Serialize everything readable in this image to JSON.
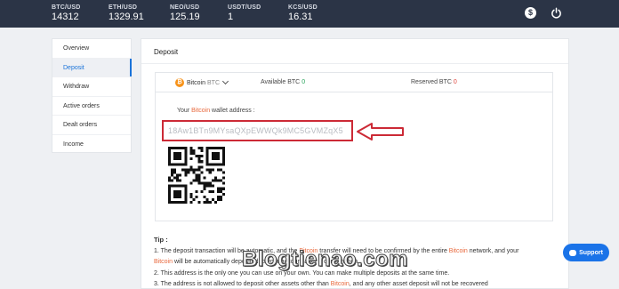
{
  "tickers": [
    {
      "pair": "BTC/USD",
      "price": "14312"
    },
    {
      "pair": "ETH/USD",
      "price": "1329.91"
    },
    {
      "pair": "NEO/USD",
      "price": "125.19"
    },
    {
      "pair": "USDT/USD",
      "price": "1"
    },
    {
      "pair": "KCS/USD",
      "price": "16.31"
    }
  ],
  "header": {
    "dollar_icon": "$",
    "power_icon": "power-icon"
  },
  "sidebar": {
    "items": [
      {
        "label": "Overview"
      },
      {
        "label": "Deposit"
      },
      {
        "label": "Withdraw"
      },
      {
        "label": "Active orders"
      },
      {
        "label": "Dealt orders"
      },
      {
        "label": "Income"
      }
    ],
    "active_index": 1
  },
  "main": {
    "title": "Deposit",
    "coin": {
      "icon": "₿",
      "name": "Bitcoin",
      "code": "BTC"
    },
    "available": {
      "label": "Available BTC",
      "value": "0"
    },
    "reserved": {
      "label": "Reserved BTC",
      "value": "0"
    },
    "wallet": {
      "label_pre": "Your ",
      "label_coin": "Bitcoin",
      "label_post": " wallet address :",
      "address": "18Aw1BTn9MYsaQXpEWWQk9MC5GVMZqX5"
    },
    "tip": {
      "title": "Tip :",
      "line1_a": "1. The deposit transaction will be automatic, and the ",
      "line1_coin": "Bitcoin",
      "line1_b": " transfer will need to be confirmed by the entire ",
      "line1_coin2": "Bitcoin",
      "line1_c": " network, and your",
      "line2_coin": "Bitcoin",
      "line2_b": " will be automatically deposited to your account after 3 confirmation.",
      "line3": "2. This address is the only one you can use on your own. You can make multiple deposits at the same time.",
      "line4_a": "3. The address is not allowed to deposit other assets other than ",
      "line4_coin": "Bitcoin",
      "line4_b": ", and any other asset deposit will not be recovered"
    }
  },
  "support": {
    "label": "Support"
  },
  "watermark": {
    "text": "Blogtienao.com"
  },
  "colors": {
    "topbar": "#2b3446",
    "accent": "#1a73d9",
    "highlight": "#e8683c",
    "address_border": "#cc2a36",
    "btc": "#f7931a"
  }
}
